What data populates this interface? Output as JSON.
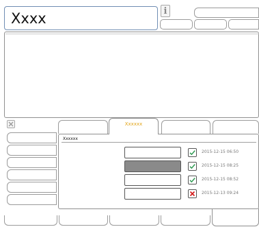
{
  "header": {
    "title": "Xxxx",
    "info_glyph": "i"
  },
  "tabs": {
    "active_label": "Xxxxxx"
  },
  "content": {
    "heading": "Xxxxxx",
    "rows": [
      {
        "status": "ok",
        "status_icon": "checkmark-icon",
        "timestamp": "2015-12-15  06:50",
        "selected": false
      },
      {
        "status": "ok",
        "status_icon": "checkmark-icon",
        "timestamp": "2015-12-15  08:25",
        "selected": true
      },
      {
        "status": "ok",
        "status_icon": "checkmark-icon",
        "timestamp": "2015-12-15  08:52",
        "selected": false
      },
      {
        "status": "error",
        "status_icon": "cross-icon",
        "timestamp": "2015-12-13  09:24",
        "selected": false
      }
    ]
  },
  "colors": {
    "ok": "#2e9a52",
    "error": "#d42020",
    "active_tab_label": "#e2a51a",
    "selected_field": "#8a8a8a"
  }
}
